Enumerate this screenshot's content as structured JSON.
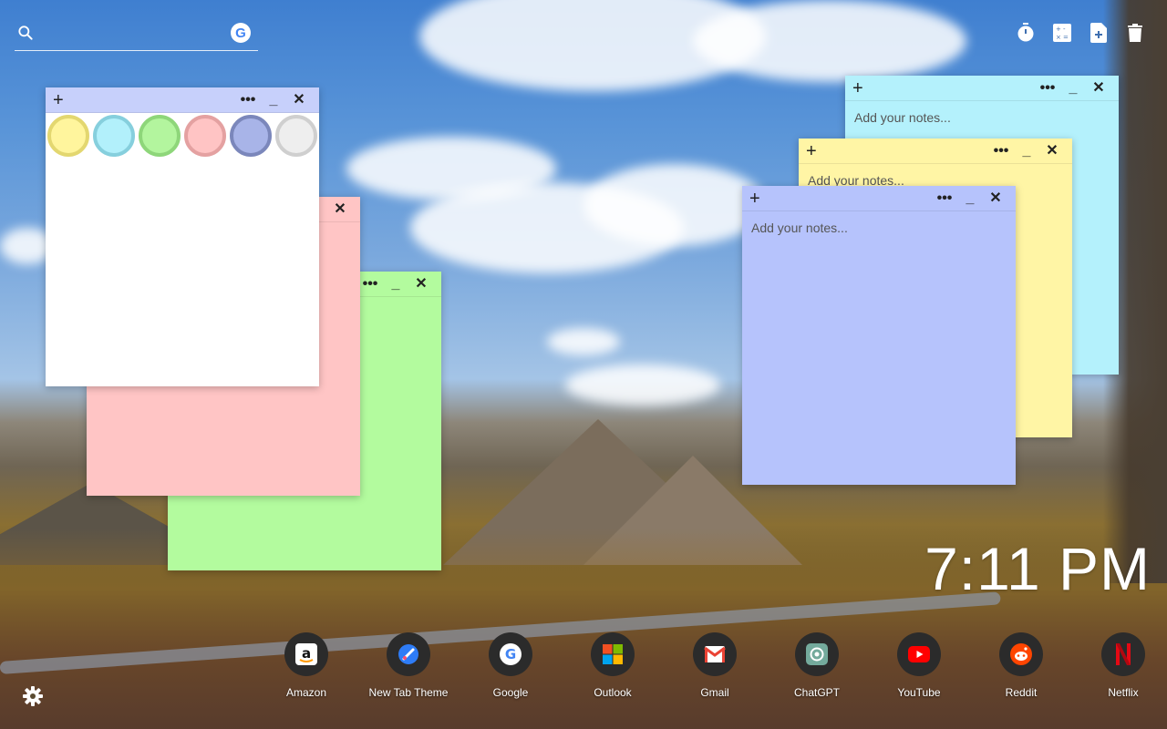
{
  "search": {
    "placeholder": ""
  },
  "toolbar": {
    "icons": [
      "timer-icon",
      "calculator-icon",
      "new-note-icon",
      "trash-icon"
    ]
  },
  "notes": {
    "color_picker_note": {
      "color": "#ffffff",
      "swatches": [
        {
          "fill": "#fff59d",
          "ring": "#e3d770"
        },
        {
          "fill": "#b2f0fb",
          "ring": "#86cfdd"
        },
        {
          "fill": "#b3f59e",
          "ring": "#8ed67a"
        },
        {
          "fill": "#ffc4c4",
          "ring": "#e4a1a1"
        },
        {
          "fill": "#a8b4e8",
          "ring": "#7b87bb"
        },
        {
          "fill": "#eeeeee",
          "ring": "#cfcfcf"
        }
      ]
    },
    "pink_note": {
      "color": "#ffc5c5"
    },
    "green_note": {
      "color": "#b3fb9e"
    },
    "cyan_note": {
      "color": "#b4f1fc",
      "placeholder": "Add your notes..."
    },
    "yellow_note": {
      "color": "#fff5a5",
      "placeholder": "Add your notes..."
    },
    "blue_note": {
      "color": "#b6c3fc",
      "placeholder": "Add your notes..."
    },
    "controls": {
      "add": "+",
      "more": "•••",
      "minimize": "_",
      "close": "✕"
    }
  },
  "clock": {
    "time": "7:11 PM"
  },
  "shortcuts": [
    {
      "label": "Amazon",
      "icon": "amazon-icon"
    },
    {
      "label": "New Tab Theme",
      "icon": "new-tab-theme-icon"
    },
    {
      "label": "Google",
      "icon": "google-icon"
    },
    {
      "label": "Outlook",
      "icon": "outlook-icon"
    },
    {
      "label": "Gmail",
      "icon": "gmail-icon"
    },
    {
      "label": "ChatGPT",
      "icon": "chatgpt-icon"
    },
    {
      "label": "YouTube",
      "icon": "youtube-icon"
    },
    {
      "label": "Reddit",
      "icon": "reddit-icon"
    },
    {
      "label": "Netflix",
      "icon": "netflix-icon"
    }
  ]
}
